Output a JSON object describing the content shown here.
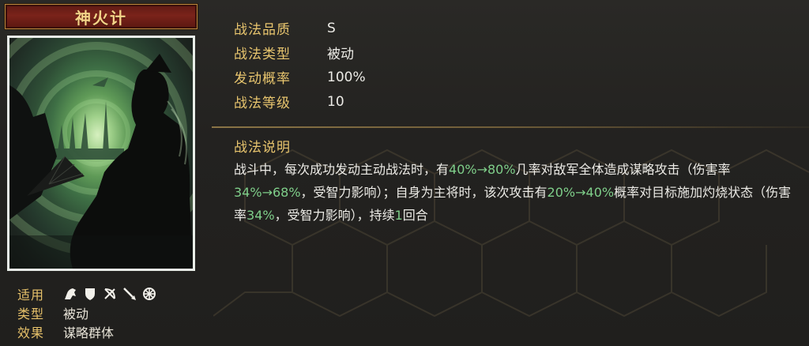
{
  "skill": {
    "name": "神火计"
  },
  "meta": {
    "applicable_label": "适用",
    "applicable_icons": [
      "cavalry-icon",
      "shield-icon",
      "bow-icon",
      "spear-icon",
      "wheel-icon"
    ],
    "type_label": "类型",
    "type_value": "被动",
    "effect_label": "效果",
    "effect_value": "谋略群体"
  },
  "stats": [
    {
      "label": "战法品质",
      "value": "S"
    },
    {
      "label": "战法类型",
      "value": "被动"
    },
    {
      "label": "发动概率",
      "value": "100%"
    },
    {
      "label": "战法等级",
      "value": "10"
    }
  ],
  "description": {
    "title": "战法说明",
    "segments": [
      {
        "text": "战斗中，每次成功发动主动战法时，有",
        "hl": false
      },
      {
        "text": "40%→80%",
        "hl": true
      },
      {
        "text": "几率对敌军全体造成谋略攻击（伤害率",
        "hl": false
      },
      {
        "text": "34%→68%",
        "hl": true
      },
      {
        "text": "，受智力影响）；自身为主将时，该次攻击有",
        "hl": false
      },
      {
        "text": "20%→40%",
        "hl": true
      },
      {
        "text": "概率对目标施加灼烧状态（伤害率",
        "hl": false
      },
      {
        "text": "34%",
        "hl": true
      },
      {
        "text": "，受智力影响），持续",
        "hl": false
      },
      {
        "text": "1",
        "hl": true
      },
      {
        "text": "回合",
        "hl": false
      }
    ]
  },
  "colors": {
    "label_gold": "#e8c56e",
    "highlight_green": "#7fcf8a",
    "title_plate_red": "#7a231a"
  }
}
